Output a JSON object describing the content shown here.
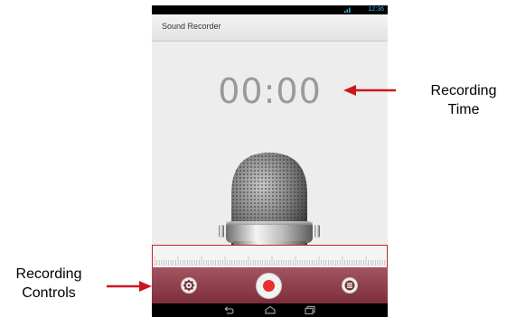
{
  "status": {
    "time": "12:36",
    "color": "#33b5e5"
  },
  "app": {
    "title": "Sound Recorder"
  },
  "recording": {
    "time": "00:00"
  },
  "controls": {
    "settings": "settings-icon",
    "record": "record-icon",
    "list": "list-icon",
    "accent": "#c0262b"
  },
  "annotations": {
    "recording_time_line1": "Recording",
    "recording_time_line2": "Time",
    "recording_controls_line1": "Recording",
    "recording_controls_line2": "Controls",
    "arrow_color": "#c8181e"
  },
  "navbar": {
    "icons": [
      "back-icon",
      "home-icon",
      "recent-apps-icon"
    ]
  }
}
